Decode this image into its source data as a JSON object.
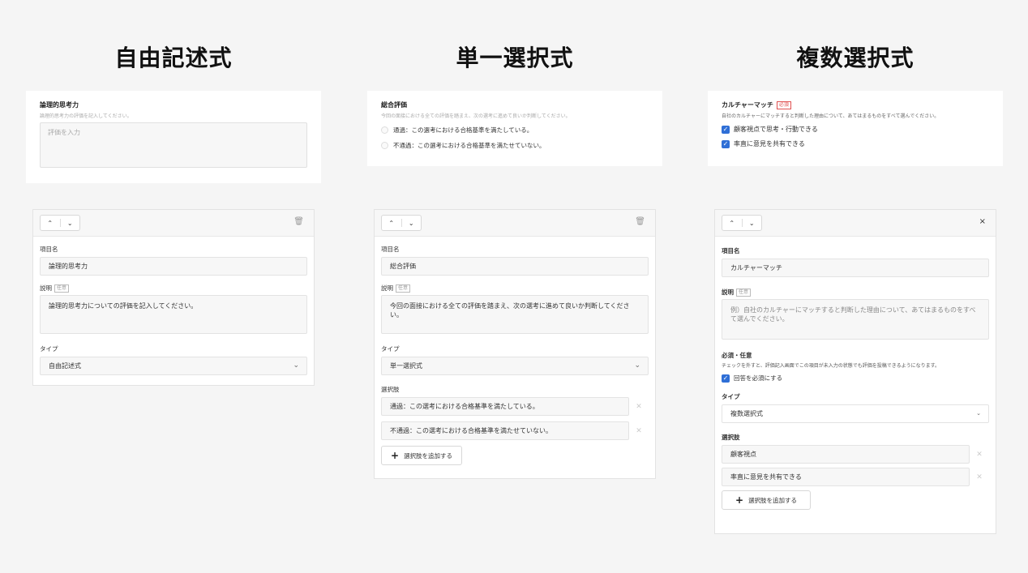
{
  "columns": {
    "free": {
      "title": "自由記述式",
      "preview": {
        "label": "論理的思考力",
        "description": "論理的思考力の評価を記入してください。",
        "placeholder": "評価を入力"
      },
      "editor": {
        "name_label": "項目名",
        "name_value": "論理的思考力",
        "desc_label": "説明",
        "optional_badge": "任意",
        "desc_value": "論理的思考力についての評価を記入してください。",
        "type_label": "タイプ",
        "type_value": "自由記述式"
      }
    },
    "single": {
      "title": "単一選択式",
      "preview": {
        "label": "総合評価",
        "description": "今回の面接における全ての評価を踏まえ、次の選考に進めて良いか判断してください。",
        "options": [
          "通過：この選考における合格基準を満たしている。",
          "不通過：この選考における合格基準を満たせていない。"
        ]
      },
      "editor": {
        "name_label": "項目名",
        "name_value": "総合評価",
        "desc_label": "説明",
        "optional_badge": "任意",
        "desc_value": "今回の面接における全ての評価を踏まえ、次の選考に進めて良いか判断してください。",
        "type_label": "タイプ",
        "type_value": "単一選択式",
        "options_label": "選択肢",
        "options": [
          "通過：この選考における合格基準を満たしている。",
          "不通過：この選考における合格基準を満たせていない。"
        ],
        "add_option": "選択肢を追加する"
      }
    },
    "multi": {
      "title": "複数選択式",
      "preview": {
        "label": "カルチャーマッチ",
        "required_badge": "必須",
        "description": "自社のカルチャーにマッチすると判断した理由について、あてはまるものをすべて選んでください。",
        "options": [
          "顧客視点で思考・行動できる",
          "率直に意見を共有できる"
        ]
      },
      "editor": {
        "close": "×",
        "name_label": "項目名",
        "name_value": "カルチャーマッチ",
        "desc_label": "説明",
        "optional_badge": "任意",
        "desc_placeholder": "例）自社のカルチャーにマッチすると判断した理由について、あてはまるものをすべて選んでください。",
        "required_label": "必須・任意",
        "required_desc": "チェックを外すと、評価記入画面でこの項目が未入力の状態でも評価を投稿できるようになります。",
        "required_check": "回答を必須にする",
        "type_label": "タイプ",
        "type_value": "複数選択式",
        "options_label": "選択肢",
        "options": [
          "顧客視点",
          "率直に意見を共有できる"
        ],
        "add_option": "選択肢を追加する"
      }
    }
  },
  "icons": {
    "up": "chevron-up-icon",
    "down": "chevron-down-icon",
    "trash": "trash-icon",
    "close": "close-icon",
    "check": "check-icon",
    "plus": "plus-icon"
  },
  "colors": {
    "accent": "#2f6fd6",
    "required": "#e05050",
    "background": "#f5f5f5"
  }
}
